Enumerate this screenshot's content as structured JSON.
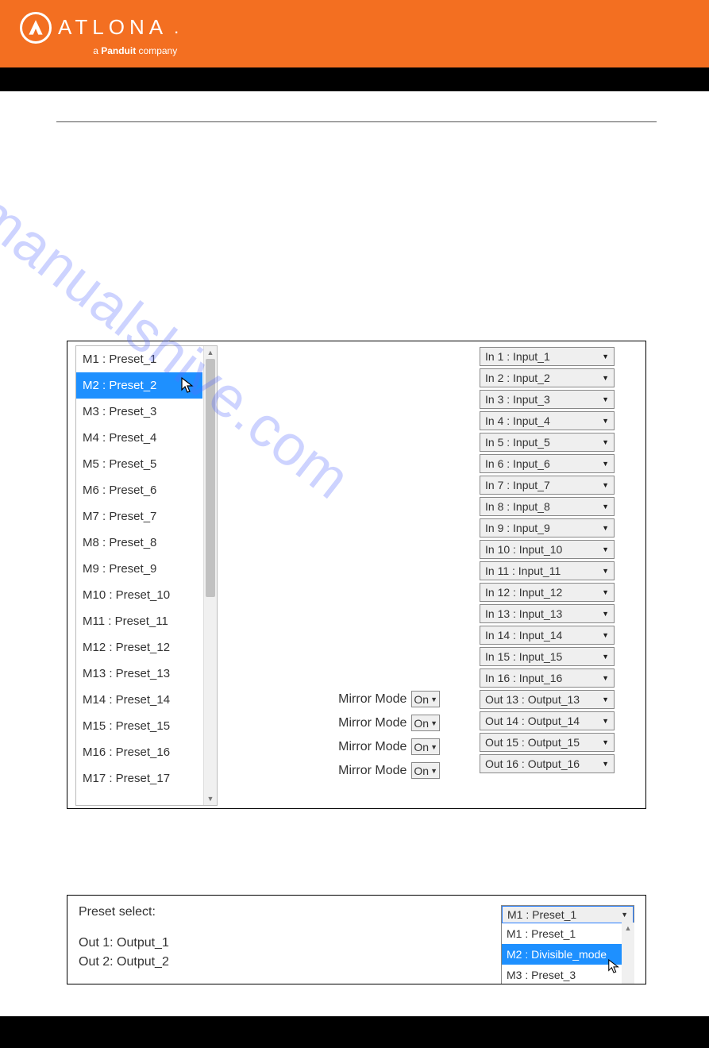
{
  "header": {
    "brand": "ATLONA",
    "tagline_prefix": "a ",
    "tagline_brand": "Panduit",
    "tagline_suffix": " company"
  },
  "watermark": "manualshive.com",
  "panel1": {
    "presets": [
      "M1 : Preset_1",
      "M2 : Preset_2",
      "M3 : Preset_3",
      "M4 : Preset_4",
      "M5 : Preset_5",
      "M6 : Preset_6",
      "M7 : Preset_7",
      "M8 : Preset_8",
      "M9 : Preset_9",
      "M10 : Preset_10",
      "M11 : Preset_11",
      "M12 : Preset_12",
      "M13 : Preset_13",
      "M14 : Preset_14",
      "M15 : Preset_15",
      "M16 : Preset_16",
      "M17 : Preset_17"
    ],
    "selected_index": 1,
    "mirror_label": "Mirror Mode",
    "mirror_options": [
      "On",
      "On",
      "On",
      "On"
    ],
    "inputs": [
      "In 1 : Input_1",
      "In 2 : Input_2",
      "In 3 : Input_3",
      "In 4 : Input_4",
      "In 5 : Input_5",
      "In 6 : Input_6",
      "In 7 : Input_7",
      "In 8 : Input_8",
      "In 9 : Input_9",
      "In 10 : Input_10",
      "In 11 : Input_11",
      "In 12 : Input_12",
      "In 13 : Input_13",
      "In 14 : Input_14",
      "In 15 : Input_15",
      "In 16 : Input_16"
    ],
    "outputs": [
      "Out 13 : Output_13",
      "Out 14 : Output_14",
      "Out 15 : Output_15",
      "Out 16 : Output_16"
    ]
  },
  "panel2": {
    "label": "Preset select:",
    "selected": "M1 : Preset_1",
    "options": [
      "M1 : Preset_1",
      "M2 : Divisible_mode",
      "M3 : Preset_3"
    ],
    "selected_option_index": 1,
    "outs": [
      "Out 1: Output_1",
      "Out 2: Output_2"
    ]
  }
}
